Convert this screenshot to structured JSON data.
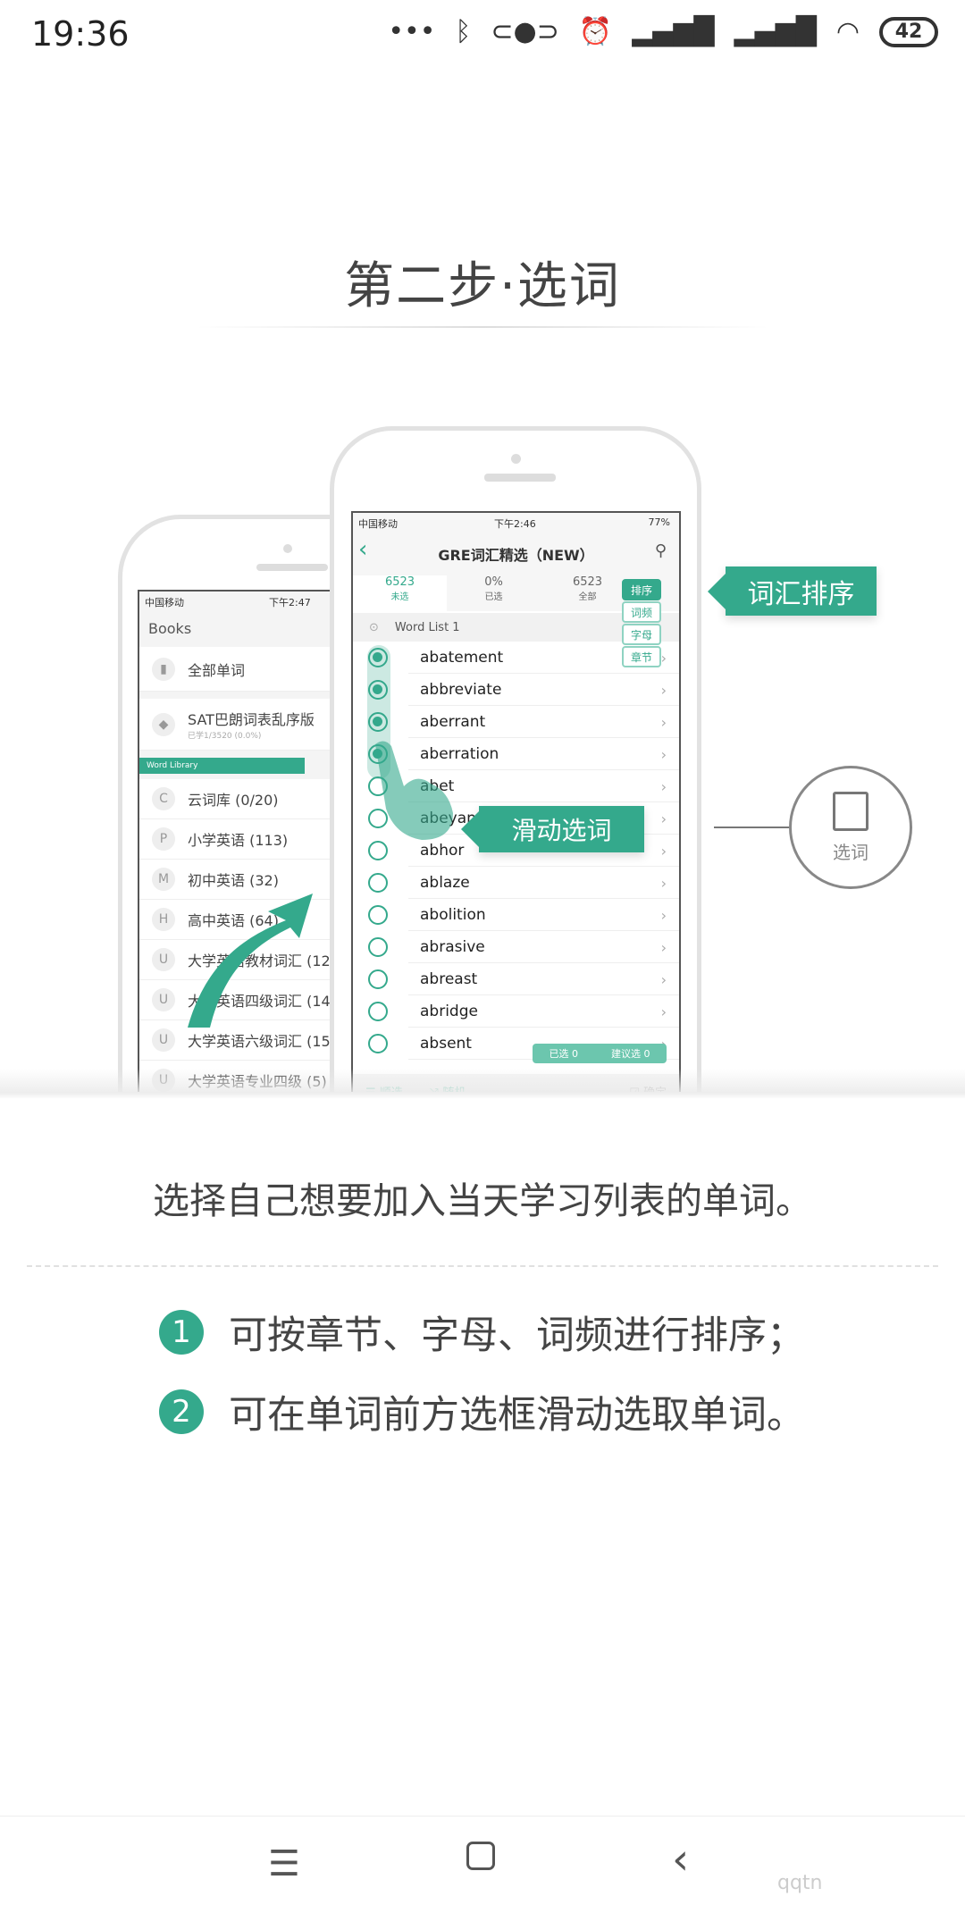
{
  "status": {
    "time": "19:36",
    "battery": "42",
    "icons": [
      "more-dots-icon",
      "bluetooth-icon",
      "toggle-icon",
      "alarm-icon",
      "hd-signal-icon",
      "signal-icon",
      "wifi-icon",
      "battery-icon"
    ]
  },
  "title": "第二步·选词",
  "illustration": {
    "left_phone": {
      "status_left": "中国移动",
      "status_time": "下午2:47",
      "header": "Books",
      "books": [
        {
          "label": "全部单词"
        },
        {
          "label": "SAT巴朗词表乱序版",
          "sub": "已学1/3520 (0.0%)"
        }
      ],
      "library_banner": "Word Library",
      "library": [
        {
          "badge": "C",
          "label": "云词库 (0/20)"
        },
        {
          "badge": "P",
          "label": "小学英语 (113)"
        },
        {
          "badge": "M",
          "label": "初中英语 (32)"
        },
        {
          "badge": "H",
          "label": "高中英语 (64)"
        },
        {
          "badge": "U",
          "label": "大学英语教材词汇 (12)"
        },
        {
          "badge": "U",
          "label": "大学英语四级词汇 (14)"
        },
        {
          "badge": "U",
          "label": "大学英语六级词汇 (15)"
        },
        {
          "badge": "U",
          "label": "大学英语专业四级 (5)"
        }
      ]
    },
    "right_phone": {
      "status_left": "中国移动",
      "status_time": "下午2:46",
      "status_battery": "77%",
      "nav_title": "GRE词汇精选（NEW）",
      "tabs": [
        {
          "value": "6523",
          "label": "未选"
        },
        {
          "value": "0%",
          "label": "已选"
        },
        {
          "value": "6523",
          "label": "全部"
        }
      ],
      "sort_buttons": [
        "排序",
        "词频",
        "字母",
        "章节"
      ],
      "list_header": "Word List 1",
      "words": [
        {
          "w": "abatement",
          "on": true
        },
        {
          "w": "abbreviate",
          "on": true
        },
        {
          "w": "aberrant",
          "on": true
        },
        {
          "w": "aberration",
          "on": true
        },
        {
          "w": "abet",
          "on": false
        },
        {
          "w": "abeyance",
          "on": false
        },
        {
          "w": "abhor",
          "on": false
        },
        {
          "w": "ablaze",
          "on": false
        },
        {
          "w": "abolition",
          "on": false
        },
        {
          "w": "abrasive",
          "on": false
        },
        {
          "w": "abreast",
          "on": false
        },
        {
          "w": "abridge",
          "on": false
        },
        {
          "w": "absent",
          "on": false
        }
      ],
      "selected_pill": "已选 0",
      "suggest_pill": "建议选 0",
      "toolbar": {
        "order": "顺选",
        "random": "随机",
        "confirm": "确定"
      }
    },
    "callout_sort": "词汇排序",
    "callout_swipe": "滑动选词",
    "circle_label": "选词",
    "accent": "#34a98c"
  },
  "description": "选择自己想要加入当天学习列表的单词。",
  "tips": [
    {
      "n": "1",
      "text": "可按章节、字母、词频进行排序；"
    },
    {
      "n": "2",
      "text": "可在单词前方选框滑动选取单词。"
    }
  ],
  "watermark": "腾牛网 qqtn.com"
}
